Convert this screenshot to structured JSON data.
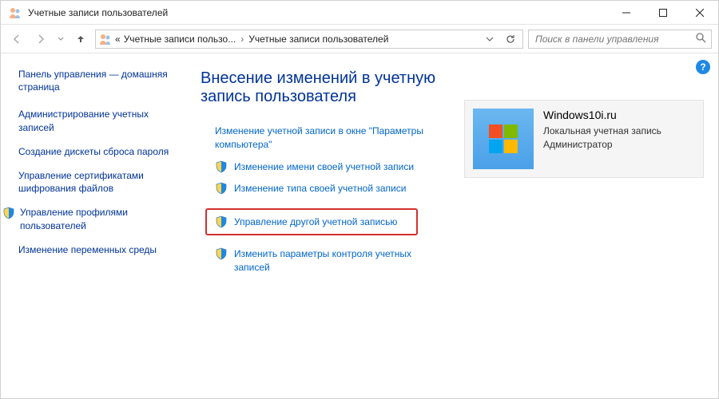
{
  "window": {
    "title": "Учетные записи пользователей"
  },
  "breadcrumb": {
    "prefix": "«",
    "crumb1": "Учетные записи пользо...",
    "crumb2": "Учетные записи пользователей"
  },
  "search": {
    "placeholder": "Поиск в панели управления"
  },
  "help": {
    "label": "?"
  },
  "sidebar": {
    "home": "Панель управления — домашняя страница",
    "items": [
      {
        "label": "Администрирование учетных записей",
        "shield": false
      },
      {
        "label": "Создание дискеты сброса пароля",
        "shield": false
      },
      {
        "label": "Управление сертификатами шифрования файлов",
        "shield": false
      },
      {
        "label": "Управление профилями пользователей",
        "shield": true
      },
      {
        "label": "Изменение переменных среды",
        "shield": false
      }
    ]
  },
  "main": {
    "heading": "Внесение изменений в учетную запись пользователя",
    "actions": [
      {
        "label": "Изменение учетной записи в окне \"Параметры компьютера\"",
        "shield": false,
        "highlight": false
      },
      {
        "label": "Изменение имени своей учетной записи",
        "shield": true,
        "highlight": false
      },
      {
        "label": "Изменение типа своей учетной записи",
        "shield": true,
        "highlight": false
      },
      {
        "label": "Управление другой учетной записью",
        "shield": true,
        "highlight": true
      },
      {
        "label": "Изменить параметры контроля учетных записей",
        "shield": true,
        "highlight": false
      }
    ]
  },
  "account": {
    "name": "Windows10i.ru",
    "line1": "Локальная учетная запись",
    "line2": "Администратор"
  }
}
